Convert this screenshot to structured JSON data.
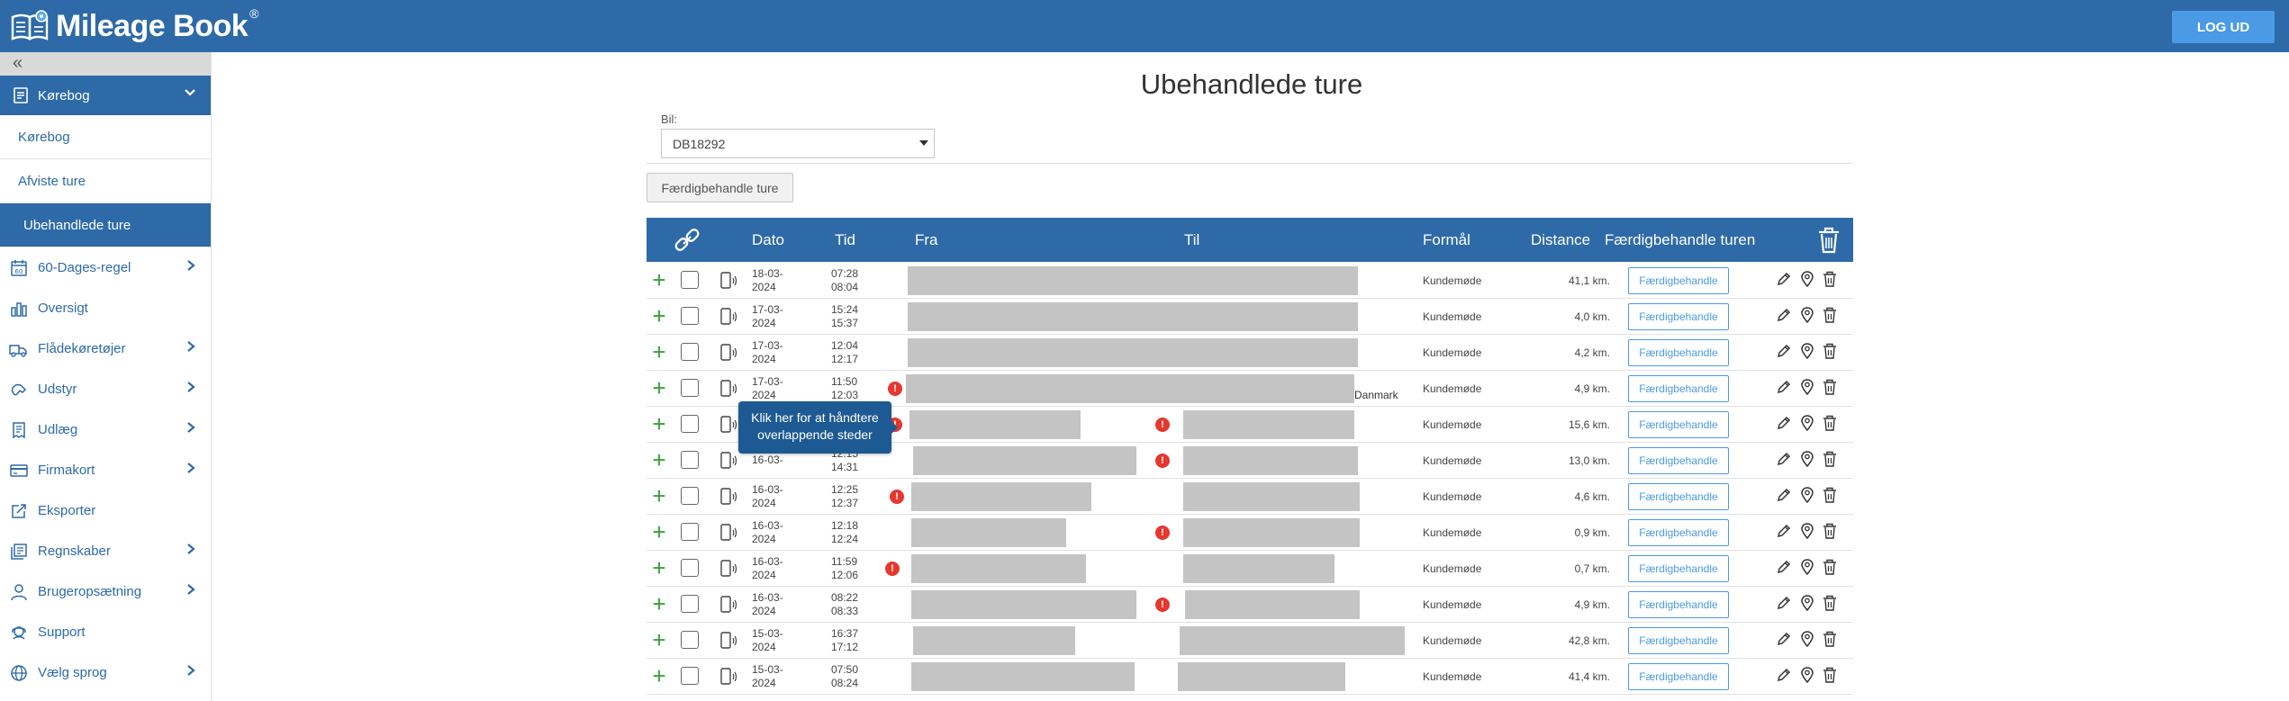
{
  "header": {
    "app_name": "Mileage Book",
    "registered_mark": "®",
    "logout_label": "LOG UD",
    "brand_color": "#2e6aa8"
  },
  "sidebar": {
    "collapse_label": "«",
    "section": {
      "label": "Kørebog"
    },
    "subitems": [
      {
        "label": "Kørebog",
        "active": false
      },
      {
        "label": "Afviste ture",
        "active": false
      },
      {
        "label": "Ubehandlede ture",
        "active": true
      }
    ],
    "items": [
      {
        "label": "60-Dages-regel",
        "icon": "calendar-60-icon",
        "has_arrow": true
      },
      {
        "label": "Oversigt",
        "icon": "bar-chart-icon",
        "has_arrow": false
      },
      {
        "label": "Flådekøretøjer",
        "icon": "fleet-vehicles-icon",
        "has_arrow": true
      },
      {
        "label": "Udstyr",
        "icon": "equipment-icon",
        "has_arrow": true
      },
      {
        "label": "Udlæg",
        "icon": "receipt-icon",
        "has_arrow": true
      },
      {
        "label": "Firmakort",
        "icon": "credit-card-icon",
        "has_arrow": true
      },
      {
        "label": "Eksporter",
        "icon": "export-icon",
        "has_arrow": false
      },
      {
        "label": "Regnskaber",
        "icon": "accounts-icon",
        "has_arrow": true
      },
      {
        "label": "Brugeropsætning",
        "icon": "user-icon",
        "has_arrow": true
      },
      {
        "label": "Support",
        "icon": "support-icon",
        "has_arrow": false
      },
      {
        "label": "Vælg sprog",
        "icon": "globe-icon",
        "has_arrow": true
      }
    ]
  },
  "main": {
    "title": "Ubehandlede ture",
    "car_label": "Bil:",
    "car_value": "DB18292",
    "finalize_trips_label": "Færdigbehandle ture",
    "tooltip": "Klik her for at håndtere overlappende steder",
    "columns": [
      "Dato",
      "Tid",
      "Fra",
      "Til",
      "Formål",
      "Distance",
      "Færdigbehandle turen"
    ],
    "rows": [
      {
        "date1": "18-03-",
        "date2": "2024",
        "time1": "07:28",
        "time2": "08:04",
        "purpose": "Kundemøde",
        "distance": "41,1 km.",
        "action": "Færdigbehandle"
      },
      {
        "date1": "17-03-",
        "date2": "2024",
        "time1": "15:24",
        "time2": "15:37",
        "purpose": "Kundemøde",
        "distance": "4,0 km.",
        "action": "Færdigbehandle"
      },
      {
        "date1": "17-03-",
        "date2": "2024",
        "time1": "12:04",
        "time2": "12:17",
        "purpose": "Kundemøde",
        "distance": "4,2 km.",
        "action": "Færdigbehandle"
      },
      {
        "date1": "17-03-",
        "date2": "2024",
        "time1": "11:50",
        "time2": "12:03",
        "purpose": "Kundemøde",
        "distance": "4,9 km.",
        "action": "Færdigbehandle",
        "country": "Danmark"
      },
      {
        "date1": "",
        "date2": "",
        "time1": "",
        "time2": "",
        "purpose": "Kundemøde",
        "distance": "15,6 km.",
        "action": "Færdigbehandle"
      },
      {
        "date1": "16-03-",
        "date2": "",
        "time1": "12:15",
        "time2": "14:31",
        "purpose": "Kundemøde",
        "distance": "13,0 km.",
        "action": "Færdigbehandle"
      },
      {
        "date1": "16-03-",
        "date2": "2024",
        "time1": "12:25",
        "time2": "12:37",
        "purpose": "Kundemøde",
        "distance": "4,6 km.",
        "action": "Færdigbehandle"
      },
      {
        "date1": "16-03-",
        "date2": "2024",
        "time1": "12:18",
        "time2": "12:24",
        "purpose": "Kundemøde",
        "distance": "0,9 km.",
        "action": "Færdigbehandle"
      },
      {
        "date1": "16-03-",
        "date2": "2024",
        "time1": "11:59",
        "time2": "12:06",
        "purpose": "Kundemøde",
        "distance": "0,7 km.",
        "action": "Færdigbehandle"
      },
      {
        "date1": "16-03-",
        "date2": "2024",
        "time1": "08:22",
        "time2": "08:33",
        "purpose": "Kundemøde",
        "distance": "4,9 km.",
        "action": "Færdigbehandle"
      },
      {
        "date1": "15-03-",
        "date2": "2024",
        "time1": "16:37",
        "time2": "17:12",
        "purpose": "Kundemøde",
        "distance": "42,8 km.",
        "action": "Færdigbehandle"
      },
      {
        "date1": "15-03-",
        "date2": "2024",
        "time1": "07:50",
        "time2": "08:24",
        "purpose": "Kundemøde",
        "distance": "41,4 km.",
        "action": "Færdigbehandle"
      }
    ]
  }
}
